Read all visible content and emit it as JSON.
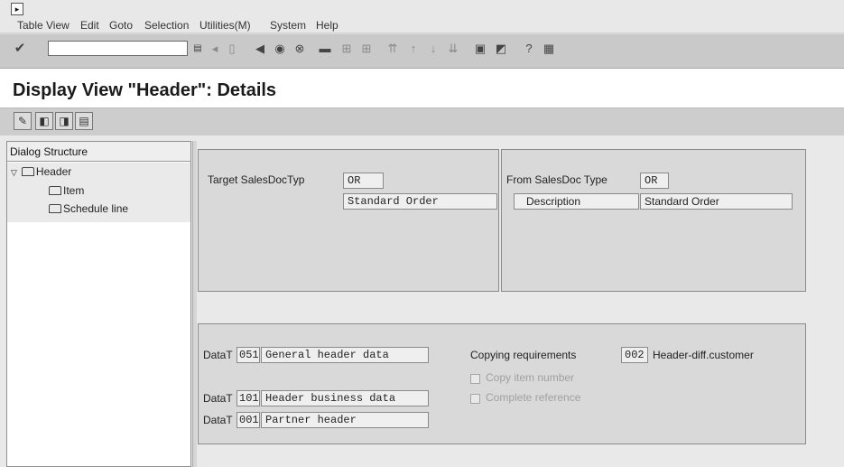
{
  "menubar": {
    "items": [
      "Table View",
      "Edit",
      "Goto",
      "Selection",
      "Utilities(M)",
      "System",
      "Help"
    ]
  },
  "toolbar": {
    "command_field_value": "",
    "icons": [
      "enter-icon",
      "save-icon",
      "back-icon",
      "exit-icon",
      "cancel-icon",
      "print-icon",
      "find-icon",
      "find-next-icon",
      "first-page-icon",
      "prev-page-icon",
      "next-page-icon",
      "last-page-icon",
      "new-session-icon",
      "shortcut-icon",
      "help-icon",
      "layout-icon"
    ]
  },
  "page": {
    "title": "Display View \"Header\": Details"
  },
  "app_toolbar": {
    "icons": [
      "display-change-icon",
      "prev-entry-icon",
      "next-entry-icon",
      "variant-icon"
    ]
  },
  "dialog_structure": {
    "title": "Dialog Structure",
    "nodes": [
      "Header",
      "Item",
      "Schedule line"
    ]
  },
  "target_group": {
    "label": "Target SalesDocTyp",
    "value": "OR",
    "description": "Standard Order"
  },
  "source_group": {
    "label": "From SalesDoc Type",
    "value": "OR",
    "description_label": "Description",
    "description": "Standard Order"
  },
  "data_group": {
    "rows": [
      {
        "label": "DataT",
        "code": "051",
        "text": "General header data"
      },
      {
        "label": "DataT",
        "code": "101",
        "text": "Header business data"
      },
      {
        "label": "DataT",
        "code": "001",
        "text": "Partner header"
      }
    ],
    "copying_requirements": {
      "label": "Copying requirements",
      "code": "002",
      "text": "Header-diff.customer"
    },
    "checkboxes": [
      {
        "label": "Copy item number",
        "checked": false
      },
      {
        "label": "Complete reference",
        "checked": false
      }
    ]
  }
}
